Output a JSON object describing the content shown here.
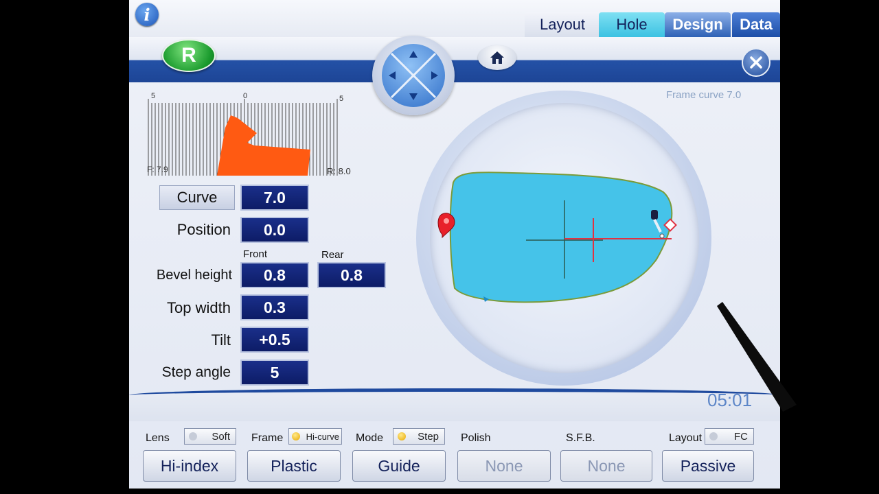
{
  "header": {
    "info_label": "i",
    "tabs": [
      {
        "label": "Layout"
      },
      {
        "label": "Hole"
      },
      {
        "label": "Design"
      },
      {
        "label": "Data"
      }
    ],
    "side_button": "R"
  },
  "histogram": {
    "left_tick": "5",
    "center_tick": "0",
    "right_tick": "5",
    "front_label": "F: 7.9",
    "rear_label": "R: 8.0",
    "fill_color": "#ff5a12"
  },
  "fields": {
    "curve": {
      "label": "Curve",
      "value": "7.0"
    },
    "position": {
      "label": "Position",
      "value": "0.0"
    },
    "front_head": "Front",
    "rear_head": "Rear",
    "bevel_height": {
      "label": "Bevel height",
      "front": "0.8",
      "rear": "0.8"
    },
    "top_width": {
      "label": "Top width",
      "value": "0.3"
    },
    "tilt": {
      "label": "Tilt",
      "value": "+0.5"
    },
    "step_angle": {
      "label": "Step angle",
      "value": "5"
    }
  },
  "frame_curve": "Frame curve  7.0",
  "lens_color": "#45c3e9",
  "clock": "05:01",
  "options": {
    "lens": {
      "label": "Lens",
      "toggle": "Soft",
      "button": "Hi-index"
    },
    "frame": {
      "label": "Frame",
      "toggle": "Hi-curve",
      "button": "Plastic"
    },
    "mode": {
      "label": "Mode",
      "toggle": "Step",
      "button": "Guide"
    },
    "polish": {
      "label": "Polish",
      "button": "None"
    },
    "sfb": {
      "label": "S.F.B.",
      "button": "None"
    },
    "layout": {
      "label": "Layout",
      "toggle": "FC",
      "button": "Passive"
    }
  }
}
